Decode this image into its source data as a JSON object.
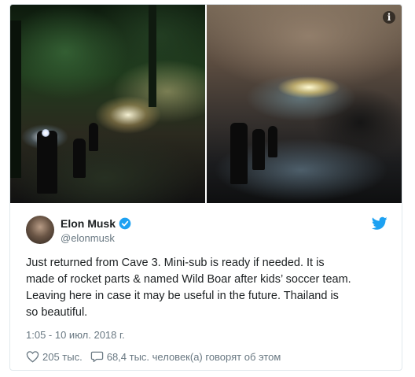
{
  "media": {
    "left_photo": "night jungle rescue camp",
    "right_photo": "flooded cave entrance",
    "info_icon_label": "i"
  },
  "author": {
    "name": "Elon Musk",
    "handle": "@elonmusk",
    "verified_icon": "verified-badge-icon",
    "platform_icon": "twitter-bird-icon"
  },
  "tweet": {
    "text": "Just returned from Cave 3. Mini-sub is ready if needed. It is\nmade of rocket parts & named Wild Boar after kids’ soccer team.\nLeaving here in case it may be useful in the future. Thailand is\nso beautiful.",
    "timestamp": "1:05 - 10 июл. 2018 г."
  },
  "actions": {
    "likes": "205 тыс.",
    "talking": "68,4 тыс. человек(а) говорят об этом"
  },
  "colors": {
    "accent": "#1da1f2",
    "muted": "#697882",
    "text": "#1c2022",
    "border": "#e1e8ed"
  }
}
